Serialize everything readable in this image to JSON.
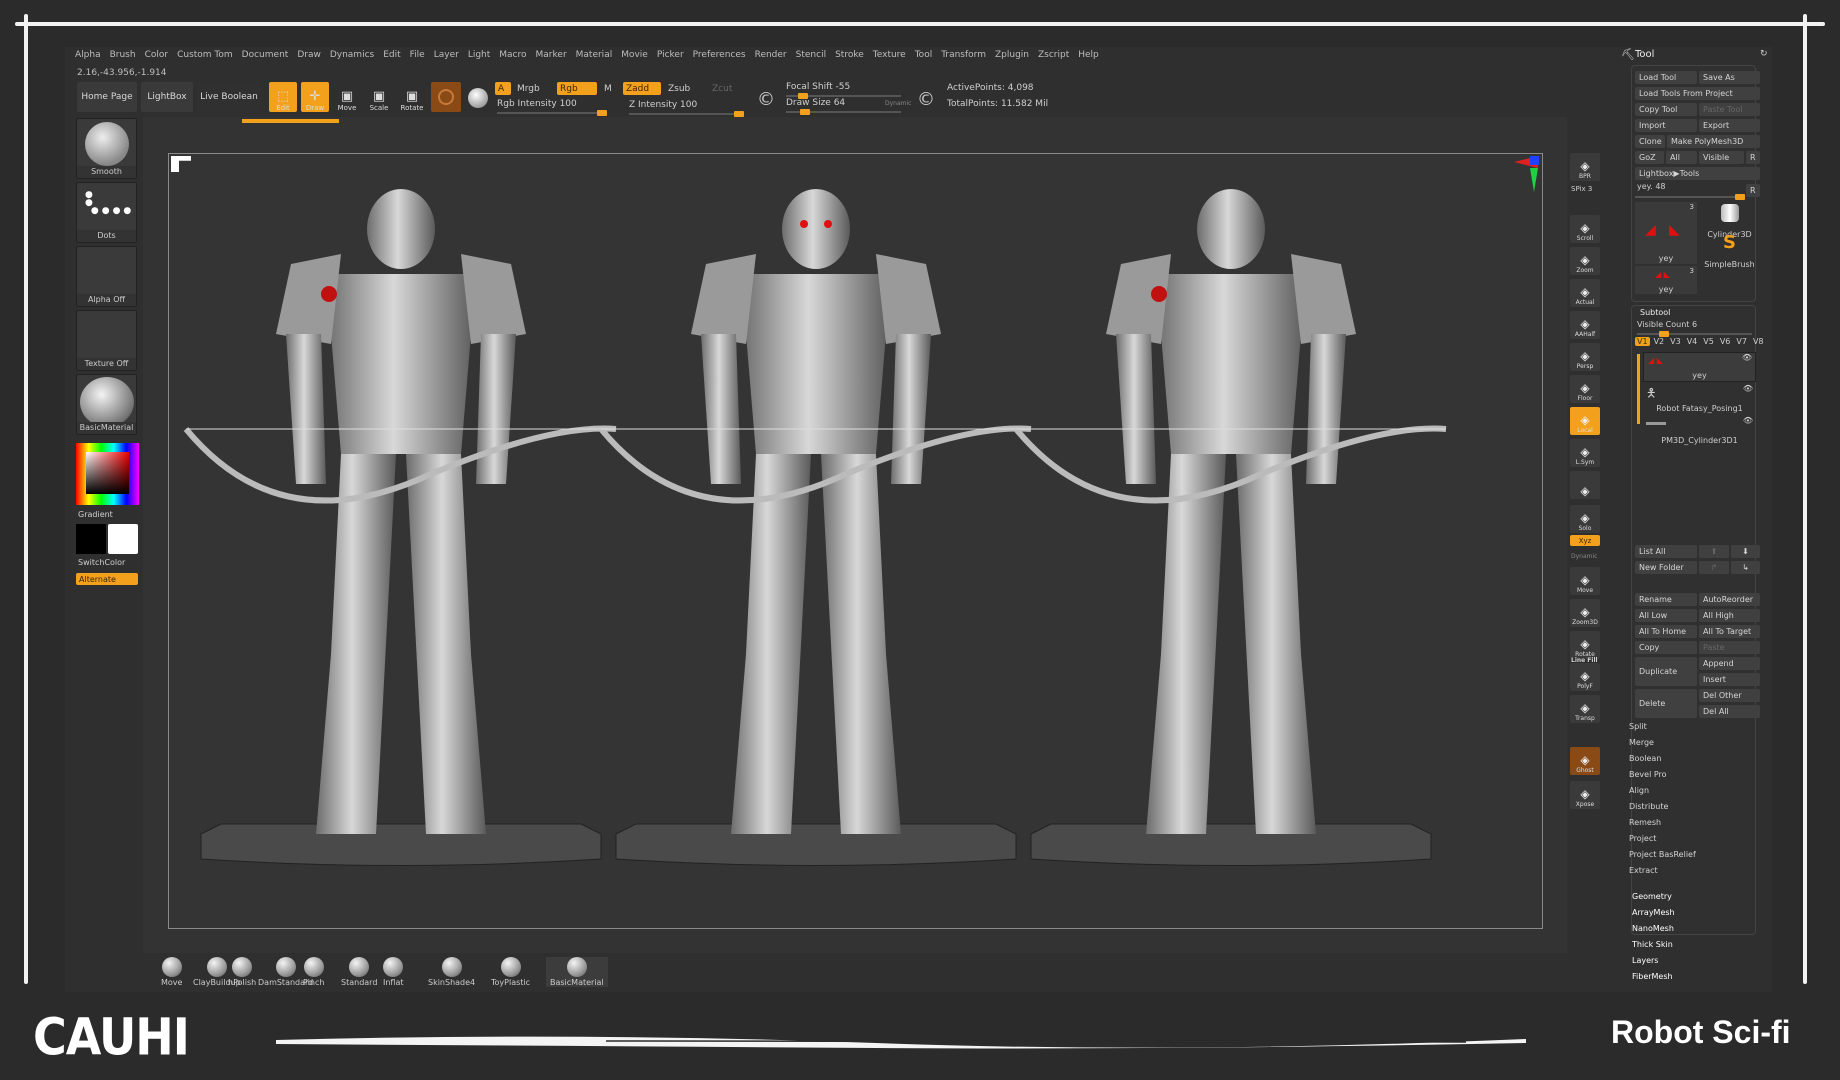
{
  "menu": [
    "Alpha",
    "Brush",
    "Color",
    "Custom Tom",
    "Document",
    "Draw",
    "Dynamics",
    "Edit",
    "File",
    "Layer",
    "Light",
    "Macro",
    "Marker",
    "Material",
    "Movie",
    "Picker",
    "Preferences",
    "Render",
    "Stencil",
    "Stroke",
    "Texture",
    "Tool",
    "Transform",
    "Zplugin",
    "Zscript",
    "Help"
  ],
  "coords": "2.16,-43.956,-1.914",
  "toolbar": {
    "home": "Home Page",
    "lightbox": "LightBox",
    "live_boolean": "Live Boolean",
    "edit": "Edit",
    "draw": "Draw",
    "move": "Move",
    "scale": "Scale",
    "rotate": "Rotate",
    "a": "A",
    "mrgb": "Mrgb",
    "rgb": "Rgb",
    "m": "M",
    "zadd": "Zadd",
    "zsub": "Zsub",
    "zcut": "Zcut",
    "rgb_intensity": "Rgb Intensity 100",
    "z_intensity": "Z Intensity 100",
    "focal_shift": "Focal Shift -55",
    "draw_size": "Draw Size 64",
    "dynamic": "Dynamic",
    "active_points": "ActivePoints: 4,098",
    "total_points": "TotalPoints: 11.582 Mil"
  },
  "shelf": {
    "smooth": "Smooth",
    "dots": "Dots",
    "alpha": "Alpha Off",
    "texture": "Texture Off",
    "material": "BasicMaterial",
    "gradient": "Gradient",
    "switch": "SwitchColor",
    "alternate": "Alternate"
  },
  "right_tools": [
    {
      "icon": "spix-icon",
      "label": "BPR"
    },
    {
      "icon": "scroll-icon",
      "label": "Scroll"
    },
    {
      "icon": "zoom-icon",
      "label": "Zoom"
    },
    {
      "icon": "actual-icon",
      "label": "Actual"
    },
    {
      "icon": "aahalf-icon",
      "label": "AAHalf"
    },
    {
      "icon": "persp-icon",
      "label": "Persp"
    },
    {
      "icon": "floor-icon",
      "label": "Floor"
    },
    {
      "icon": "local-icon",
      "label": "Local"
    },
    {
      "icon": "lsym-icon",
      "label": "L.Sym"
    },
    {
      "icon": "lock-icon",
      "label": ""
    },
    {
      "icon": "solo-icon",
      "label": "Solo"
    },
    {
      "icon": "move-icon",
      "label": "Move"
    },
    {
      "icon": "zoom3d-icon",
      "label": "Zoom3D"
    },
    {
      "icon": "rotate-icon",
      "label": "Rotate"
    },
    {
      "icon": "polyf-icon",
      "label": "PolyF"
    },
    {
      "icon": "transp-icon",
      "label": "Transp"
    },
    {
      "icon": "ghost-icon",
      "label": "Ghost"
    },
    {
      "icon": "xpose-icon",
      "label": "Xpose"
    }
  ],
  "spix": "SPix 3",
  "xyz": "Xyz",
  "dynamic_label": "Dynamic",
  "line_fill": "Line Fill",
  "tool": {
    "title": "Tool",
    "load_tool": "Load Tool",
    "save_as": "Save As",
    "load_from_project": "Load Tools From Project",
    "copy_tool": "Copy Tool",
    "paste_tool": "Paste Tool",
    "import": "Import",
    "export": "Export",
    "clone": "Clone",
    "make_polymesh": "Make PolyMesh3D",
    "goz": "GoZ",
    "all": "All",
    "visible": "Visible",
    "r": "R",
    "lightbox_tools": "Lightbox▶Tools",
    "current": "yey. 48",
    "thumbs": [
      {
        "name": "yey",
        "count": "3"
      },
      {
        "name": "yey",
        "count": "3"
      },
      {
        "name": "Cylinder3D"
      },
      {
        "name": "SimpleBrush"
      }
    ],
    "subtool_title": "Subtool",
    "visible_count": "Visible Count 6",
    "versions": [
      "V1",
      "V2",
      "V3",
      "V4",
      "V5",
      "V6",
      "V7",
      "V8"
    ],
    "subtools": [
      "yey",
      "Robot Fatasy_Posing1",
      "PM3D_Cylinder3D1"
    ],
    "list_all": "List All",
    "new_folder": "New Folder",
    "rename": "Rename",
    "auto_reorder": "AutoReorder",
    "all_low": "All Low",
    "all_high": "All High",
    "all_to_home": "All To Home",
    "all_to_target": "All To Target",
    "copy": "Copy",
    "paste": "Paste",
    "duplicate": "Duplicate",
    "append": "Append",
    "insert": "Insert",
    "delete": "Delete",
    "del_other": "Del Other",
    "del_all": "Del All",
    "actions": [
      "Split",
      "Merge",
      "Boolean",
      "Bevel Pro",
      "Align",
      "Distribute",
      "Remesh",
      "Project",
      "Project BasRelief",
      "Extract"
    ],
    "sections": [
      "Geometry",
      "ArrayMesh",
      "NanoMesh",
      "Thick Skin",
      "Layers",
      "FiberMesh"
    ]
  },
  "brushes": [
    "Move",
    "ClayBuildup",
    "hPolish",
    "DamStandard",
    "Pinch",
    "Standard",
    "Inflat",
    "SkinShade4",
    "ToyPlastic",
    "BasicMaterial"
  ],
  "footer": {
    "logo": "CAUHI",
    "title": "Robot Sci-fi"
  },
  "colors": {
    "accent": "#f3a11c",
    "background": "#2b2b2b"
  }
}
